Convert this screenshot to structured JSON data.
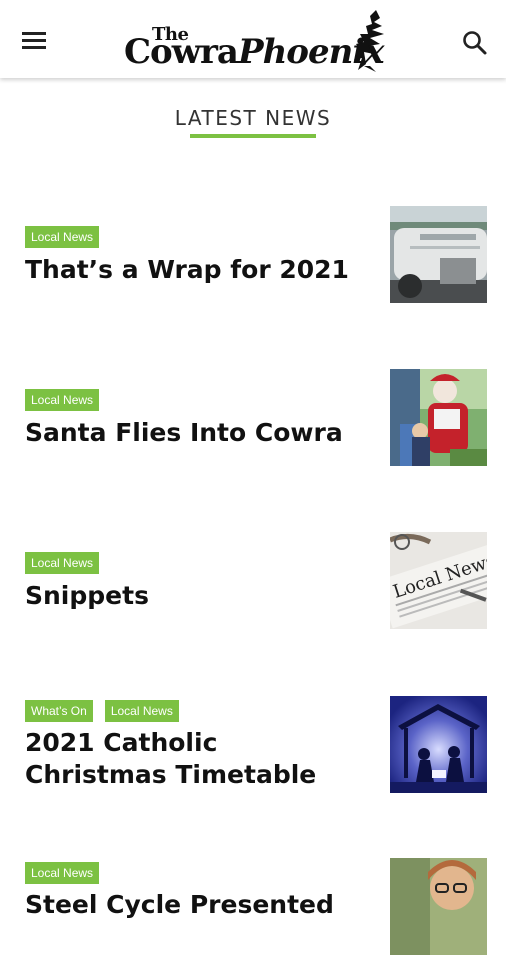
{
  "header": {
    "logo_the": "The",
    "logo_cowra": "Cowra",
    "logo_phoenix": "Phoenix"
  },
  "section": {
    "title": "LATEST NEWS"
  },
  "articles": [
    {
      "tags": [
        "Local News"
      ],
      "title": "That’s a Wrap for 2021",
      "thumbnail_icon": "train-photo"
    },
    {
      "tags": [
        "Local News"
      ],
      "title": "Santa Flies Into Cowra",
      "thumbnail_icon": "santa-photo"
    },
    {
      "tags": [
        "Local News"
      ],
      "title": "Snippets",
      "thumbnail_icon": "newspaper-photo"
    },
    {
      "tags": [
        "What’s On",
        "Local News"
      ],
      "title_line1": "2021 Catholic",
      "title_line2": "Christmas Timetable",
      "thumbnail_icon": "nativity-photo"
    },
    {
      "tags": [
        "Local News"
      ],
      "title": "Steel Cycle Presented",
      "thumbnail_icon": "portrait-photo"
    }
  ],
  "colors": {
    "accent": "#7cc142",
    "text": "#111111"
  }
}
